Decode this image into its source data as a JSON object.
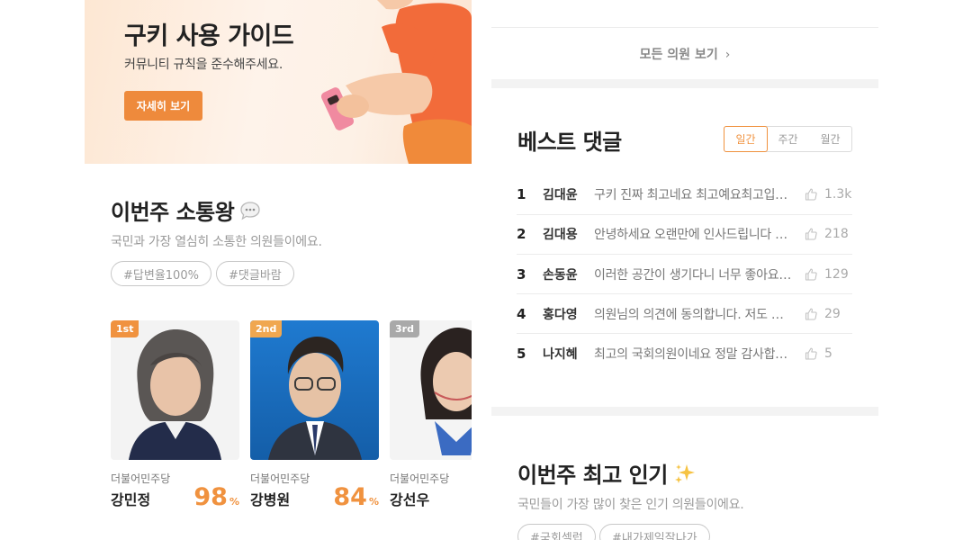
{
  "banner": {
    "title": "구키 사용 가이드",
    "subtitle": "커뮤니티 규칙을 준수해주세요.",
    "button_label": "자세히 보기"
  },
  "top_communicator": {
    "title": "이번주 소통왕",
    "title_icon": "speech-bubble-icon",
    "description": "국민과 가장 열심히 소통한 의원들이에요.",
    "tags": [
      "#답변율100%",
      "#댓글바람"
    ],
    "members": [
      {
        "rank": "1st",
        "party": "더불어민주당",
        "name": "강민정",
        "percent": "98",
        "unit": "%",
        "badge_color": "#f0923f"
      },
      {
        "rank": "2nd",
        "party": "더불어민주당",
        "name": "강병원",
        "percent": "84",
        "unit": "%",
        "badge_color": "#f0a750"
      },
      {
        "rank": "3rd",
        "party": "더불어민주당",
        "name": "강선우",
        "percent": "",
        "unit": "",
        "badge_color": "#a9a9a9"
      }
    ]
  },
  "see_all": {
    "label": "모든 의원 보기",
    "chevron": "›"
  },
  "best_comments": {
    "title": "베스트 댓글",
    "tabs": [
      "일간",
      "주간",
      "월간"
    ],
    "active_tab": "일간",
    "rows": [
      {
        "rank": "1",
        "name": "김대윤",
        "text": "구키 진짜 최고네요 최고예요최고입니다",
        "likes": "1.3k"
      },
      {
        "rank": "2",
        "name": "김대용",
        "text": "안녕하세요 오랜만에 인사드립니다 반갑습니다",
        "likes": "218"
      },
      {
        "rank": "3",
        "name": "손동윤",
        "text": "이러한 공간이 생기다니 너무 좋아요 정말로",
        "likes": "129"
      },
      {
        "rank": "4",
        "name": "홍다영",
        "text": "의원님의 의견에 동의합니다. 저도 계속 응원해요",
        "likes": "29"
      },
      {
        "rank": "5",
        "name": "나지혜",
        "text": "최고의 국회의원이네요 정말 감사합니다",
        "likes": "5"
      }
    ]
  },
  "popular": {
    "title": "이번주 최고 인기",
    "title_icon": "sparkles-icon",
    "description": "국민들이 가장 많이 찾은 인기 의원들이에요.",
    "tags": [
      "#국회셀럽",
      "#내가제일잘나가"
    ]
  },
  "colors": {
    "accent": "#f0923f",
    "button": "#ee8a3c",
    "muted": "#9a9a9a"
  }
}
